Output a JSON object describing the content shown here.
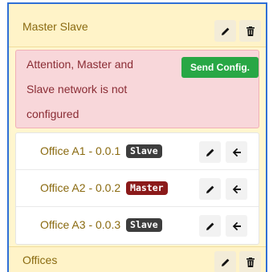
{
  "group": {
    "title": "Master Slave"
  },
  "alert": {
    "lines": [
      "Attention, Master and",
      "Slave network is not",
      "configured"
    ],
    "send_label": "Send Config."
  },
  "devices": [
    {
      "name": "Office A1 - 0.0.1",
      "role": "Slave",
      "role_color": "#3d3d3d"
    },
    {
      "name": "Office A2 - 0.0.2",
      "role": "Master",
      "role_color": "#8b1a1a"
    },
    {
      "name": "Office A3 - 0.0.3",
      "role": "Slave",
      "role_color": "#3d3d3d"
    }
  ],
  "group2": {
    "title": "Offices"
  },
  "icons": {
    "edit": "pencil-icon",
    "delete": "trash-icon",
    "move": "arrow-left-icon"
  },
  "colors": {
    "accent_border": "#2f6fd6",
    "panel_bg": "#fff3c8",
    "alert_bg": "#f8d7da",
    "success": "#28a745"
  }
}
